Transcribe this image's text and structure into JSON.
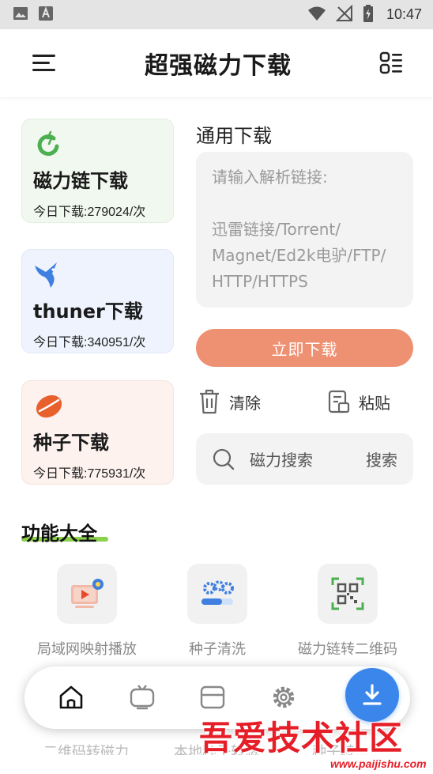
{
  "status_bar": {
    "time": "10:47",
    "icons": [
      "image-icon",
      "a-icon",
      "wifi-icon",
      "no-signal-icon",
      "battery-charging-icon"
    ]
  },
  "header": {
    "title": "超强磁力下载",
    "menu_icon": "menu-icon",
    "grid_icon": "grid-list-icon"
  },
  "cards": [
    {
      "title": "磁力链下载",
      "count": "今日下载:279024/次",
      "icon": "magnet-icon"
    },
    {
      "title": "thuner下载",
      "count": "今日下载:340951/次",
      "icon": "bird-icon"
    },
    {
      "title": "种子下载",
      "count": "今日下载:775931/次",
      "icon": "seed-icon"
    }
  ],
  "general": {
    "title": "通用下载",
    "placeholder_lines": [
      "请输入解析链接:",
      "",
      "迅雷链接/Torrent/",
      "Magnet/Ed2k电驴/FTP/",
      "HTTP/HTTPS"
    ],
    "download_button": "立即下载",
    "clear_label": "清除",
    "paste_label": "粘贴",
    "search_placeholder": "磁力搜索",
    "search_button": "搜索"
  },
  "features": {
    "title": "功能大全",
    "items": [
      {
        "label": "局域网映射播放",
        "icon": "screen-cast-icon"
      },
      {
        "label": "种子清洗",
        "icon": "gears-progress-icon"
      },
      {
        "label": "磁力链转二维码",
        "icon": "qr-code-icon"
      }
    ],
    "partial_row": [
      "二维码转磁力",
      "本地种子转磁",
      "种子转..."
    ]
  },
  "bottom_nav": {
    "items": [
      "home-icon",
      "tv-icon",
      "card-icon",
      "settings-icon"
    ],
    "fab_icon": "download-icon"
  },
  "colors": {
    "accent_button": "#ee9172",
    "fab": "#3a86ea",
    "magnet_green": "#4caf50",
    "bird_blue": "#3f7fe0",
    "seed_orange": "#e8602c",
    "underline_green": "#8bd14b"
  },
  "watermark": {
    "text": "吾爱技术社区",
    "url": "www.paijishu.com"
  }
}
